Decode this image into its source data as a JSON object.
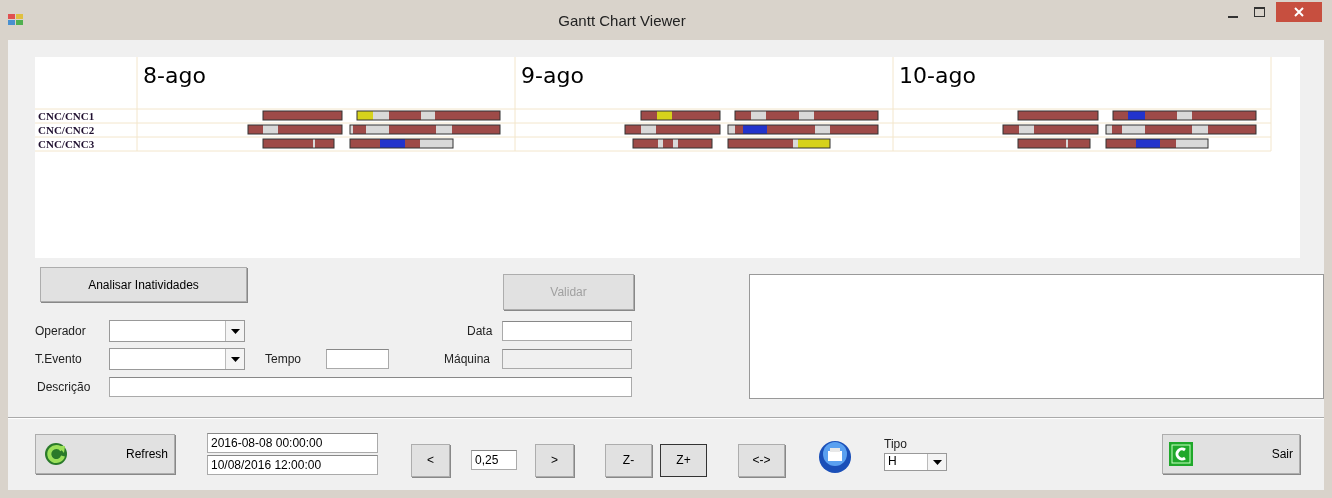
{
  "window": {
    "title": "Gantt Chart Viewer"
  },
  "gantt": {
    "days": [
      "8-ago",
      "9-ago",
      "10-ago"
    ],
    "rows": [
      "CNC/CNC1",
      "CNC/CNC2",
      "CNC/CNC3"
    ]
  },
  "form": {
    "analyze_button": {
      "label": "Analisar Inatividades",
      "disabled": false
    },
    "validate_button": {
      "label": "Validar",
      "disabled": true
    },
    "operador": {
      "label": "Operador"
    },
    "evento": {
      "label": "T.Evento"
    },
    "tempo": {
      "label": "Tempo"
    },
    "data": {
      "label": "Data"
    },
    "maquina": {
      "label": "Máquina",
      "disabled": true
    },
    "descricao": {
      "label": "Descrição"
    }
  },
  "toolbar": {
    "refresh": "Refresh",
    "date_from": "2016-08-08 00:00:00",
    "date_to": "10/08/2016 12:00:00",
    "prev": "<",
    "step": "0,25",
    "next": ">",
    "zoom_buttons": [
      {
        "label": "Z-",
        "focused": false
      },
      {
        "label": "Z+",
        "focused": true
      }
    ],
    "fit": "<->",
    "tipo": {
      "label": "Tipo",
      "value": "H"
    },
    "exit": "Sair"
  }
}
